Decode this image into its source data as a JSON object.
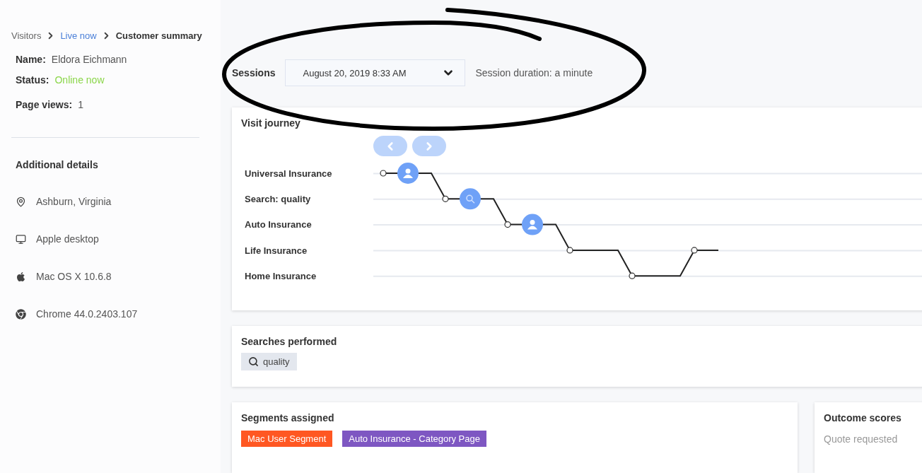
{
  "breadcrumb": [
    {
      "label": "Visitors",
      "kind": "link"
    },
    {
      "label": "Live now",
      "kind": "link"
    },
    {
      "label": "Customer summary",
      "kind": "current"
    }
  ],
  "profile": {
    "name_label": "Name:",
    "name": "Eldora Eichmann",
    "status_label": "Status:",
    "status": "Online now",
    "page_views_label": "Page views:",
    "page_views": "1"
  },
  "additional_details": {
    "title": "Additional details",
    "items": [
      {
        "kind": "location",
        "text": "Ashburn, Virginia"
      },
      {
        "kind": "device",
        "text": "Apple desktop"
      },
      {
        "kind": "os",
        "text": "Mac OS X 10.6.8"
      },
      {
        "kind": "browser",
        "text": "Chrome 44.0.2403.107"
      }
    ]
  },
  "sessions": {
    "label": "Sessions",
    "selected_session": "August 20, 2019 8:33 AM",
    "duration": "Session duration: a minute"
  },
  "visit_journey": {
    "title": "Visit journey",
    "rows": [
      {
        "label": "Universal Insurance",
        "kind": "person"
      },
      {
        "label": "Search: quality",
        "kind": "search"
      },
      {
        "label": "Auto Insurance",
        "kind": "person"
      },
      {
        "label": "Life Insurance",
        "kind": "plain"
      },
      {
        "label": "Home Insurance",
        "kind": "plain"
      }
    ]
  },
  "searches_performed": {
    "title": "Searches performed",
    "terms": [
      "quality"
    ]
  },
  "segments_assigned": {
    "title": "Segments assigned",
    "segments": [
      {
        "label": "Mac User Segment",
        "color": "#ff5722"
      },
      {
        "label": "Auto Insurance - Category Page",
        "color": "#7e57c2"
      }
    ]
  },
  "outcome_scores": {
    "title": "Outcome scores",
    "items": [
      "Quote requested"
    ]
  }
}
